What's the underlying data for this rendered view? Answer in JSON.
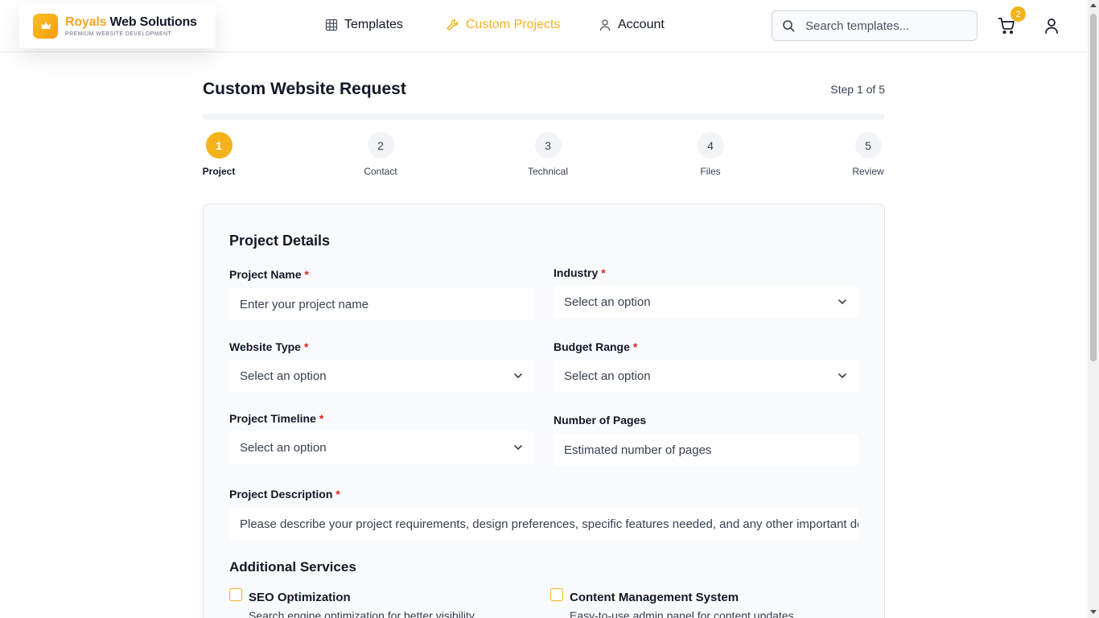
{
  "brand": {
    "name_accent": "Royals",
    "name_rest": " Web Solutions",
    "tagline": "PREMIUM WEBSITE DEVELOPMENT",
    "accent_color": "#f5b31b"
  },
  "nav": {
    "items": [
      {
        "label": "Templates",
        "icon": "grid-icon"
      },
      {
        "label": "Custom Projects",
        "icon": "wrench-icon",
        "active": true
      },
      {
        "label": "Account",
        "icon": "user-icon"
      }
    ]
  },
  "search": {
    "placeholder": "Search templates..."
  },
  "cart": {
    "count": "2"
  },
  "page": {
    "title": "Custom Website Request",
    "step_indicator": "Step 1 of 5"
  },
  "steps": [
    {
      "number": "1",
      "label": "Project",
      "active": true
    },
    {
      "number": "2",
      "label": "Contact"
    },
    {
      "number": "3",
      "label": "Technical"
    },
    {
      "number": "4",
      "label": "Files"
    },
    {
      "number": "5",
      "label": "Review"
    }
  ],
  "form": {
    "title": "Project Details",
    "required_mark": "*",
    "project_name": {
      "label": "Project Name",
      "placeholder": "Enter your project name"
    },
    "industry": {
      "label": "Industry",
      "value": "Select an option"
    },
    "website_type": {
      "label": "Website Type",
      "value": "Select an option"
    },
    "budget_range": {
      "label": "Budget Range",
      "value": "Select an option"
    },
    "project_timeline": {
      "label": "Project Timeline",
      "value": "Select an option"
    },
    "number_of_pages": {
      "label": "Number of Pages",
      "placeholder": "Estimated number of pages"
    },
    "project_description": {
      "label": "Project Description",
      "placeholder": "Please describe your project requirements, design preferences, specific features needed, and any other important details..."
    }
  },
  "additional_services": {
    "title": "Additional Services",
    "items": [
      {
        "label": "SEO Optimization",
        "description": "Search engine optimization for better visibility",
        "checked": false
      },
      {
        "label": "Content Management System",
        "description": "Easy-to-use admin panel for content updates",
        "checked": false
      }
    ]
  }
}
